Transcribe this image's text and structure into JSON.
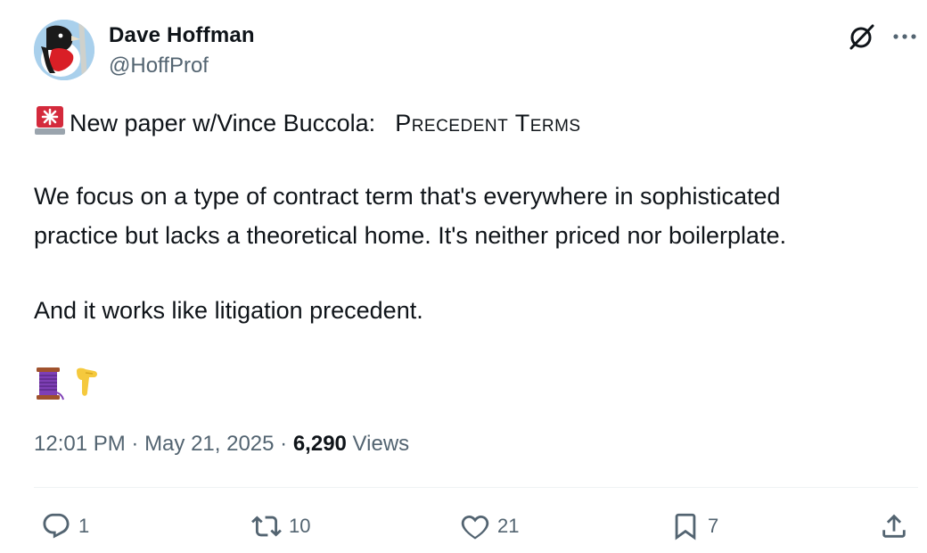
{
  "author": {
    "name": "Dave Hoffman",
    "handle": "@HoffProf"
  },
  "tweet": {
    "line1_prefix": "New paper w/Vince Buccola:",
    "line1_title": "Precedent Terms",
    "line2": "We focus on a type of contract term that's everywhere in sophisticated",
    "line3": "practice but lacks a theoretical home.  It's neither priced nor boilerplate.",
    "line4": "And it works like litigation precedent.",
    "emojis": [
      "thread-spool-emoji",
      "pointing-down-emoji"
    ]
  },
  "meta": {
    "time": "12:01 PM",
    "separator1": " · ",
    "date": "May 21, 2025",
    "separator2": " · ",
    "views_count": "6,290",
    "views_label": " Views"
  },
  "actions": {
    "replies": "1",
    "reposts": "10",
    "likes": "21",
    "bookmarks": "7"
  },
  "icons": {
    "header": [
      "grok-icon",
      "more-icon"
    ],
    "actions": [
      "reply-icon",
      "repost-icon",
      "like-icon",
      "bookmark-icon",
      "share-icon"
    ]
  },
  "colors": {
    "text": "#0f1419",
    "secondary": "#536471",
    "divider": "#eff3f4"
  }
}
